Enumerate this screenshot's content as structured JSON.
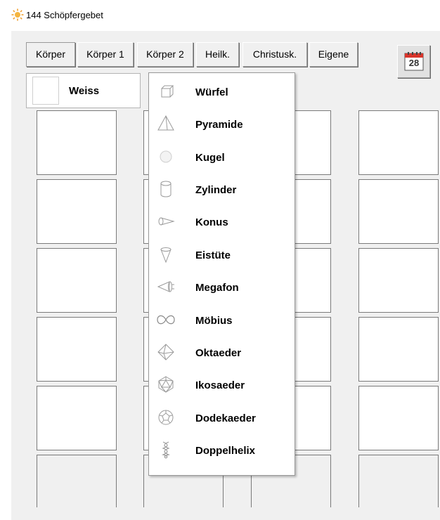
{
  "window": {
    "title": "144 Schöpfergebet",
    "icon": "sun-icon"
  },
  "tabs": [
    {
      "label": "Körper",
      "active": true
    },
    {
      "label": "Körper 1",
      "active": false
    },
    {
      "label": "Körper 2",
      "active": false
    },
    {
      "label": "Heilk.",
      "active": false
    },
    {
      "label": "Christusk.",
      "active": false
    },
    {
      "label": "Eigene",
      "active": false
    }
  ],
  "calendar": {
    "day": "28",
    "icon": "calendar-icon"
  },
  "color_select": {
    "value": "Weiss",
    "swatch_color": "#ffffff"
  },
  "grid": {
    "columns": 4,
    "rows": 6
  },
  "menu": {
    "items": [
      {
        "label": "Würfel",
        "icon": "cube-icon"
      },
      {
        "label": "Pyramide",
        "icon": "pyramid-icon"
      },
      {
        "label": "Kugel",
        "icon": "sphere-icon"
      },
      {
        "label": "Zylinder",
        "icon": "cylinder-icon"
      },
      {
        "label": "Konus",
        "icon": "cone-icon"
      },
      {
        "label": "Eistüte",
        "icon": "ice-cream-cone-icon"
      },
      {
        "label": "Megafon",
        "icon": "megaphone-icon"
      },
      {
        "label": "Möbius",
        "icon": "mobius-icon"
      },
      {
        "label": "Oktaeder",
        "icon": "octahedron-icon"
      },
      {
        "label": "Ikosaeder",
        "icon": "icosahedron-icon"
      },
      {
        "label": "Dodekaeder",
        "icon": "dodecahedron-icon"
      },
      {
        "label": "Doppelhelix",
        "icon": "double-helix-icon"
      }
    ]
  },
  "colors": {
    "window_bg": "#f0f0f0",
    "cell_border": "#7a7a7a",
    "icon_gray": "#9a9a9a"
  }
}
